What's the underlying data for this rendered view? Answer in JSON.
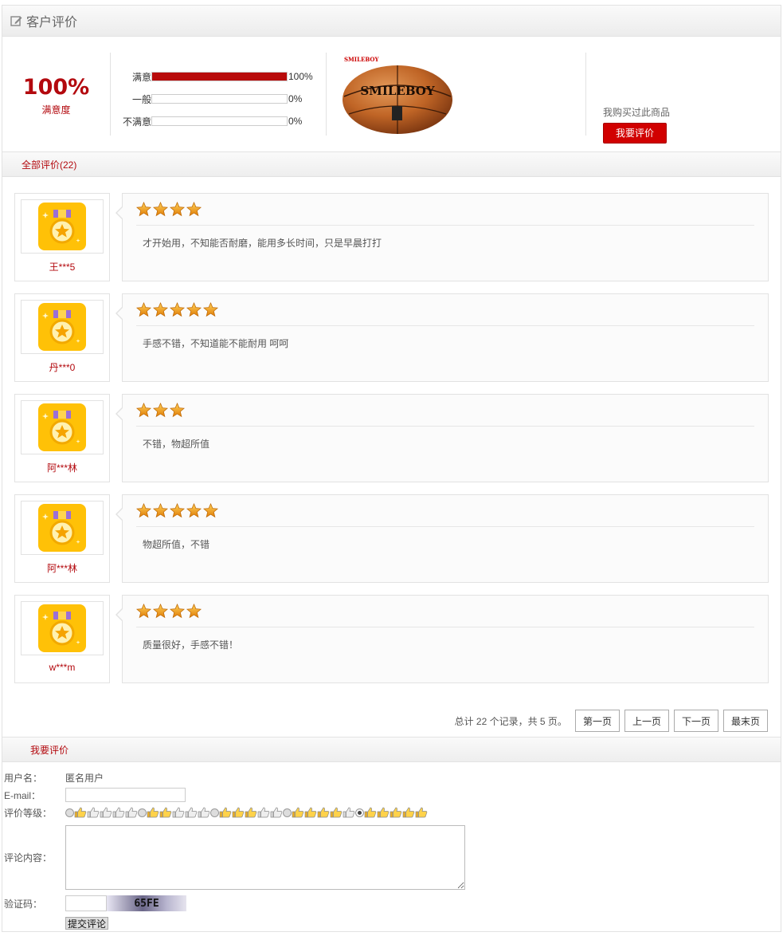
{
  "header": {
    "title": "客户评价"
  },
  "summary": {
    "percent": "100%",
    "percent_label": "满意度",
    "rows": [
      {
        "label": "满意",
        "value": "100%",
        "fill": 1.0
      },
      {
        "label": "一般",
        "value": "0%",
        "fill": 0
      },
      {
        "label": "不满意",
        "value": "0%",
        "fill": 0
      }
    ],
    "product_brand_small": "SMILEBOY",
    "product_brand": "SMILEBOY",
    "buy_text": "我购买过此商品",
    "buy_button": "我要评价"
  },
  "tab_all": "全部评价(22)",
  "reviews": [
    {
      "user": "王***5",
      "stars": 4,
      "text": "才开始用，不知能否耐磨，能用多长时间，只是早晨打打"
    },
    {
      "user": "丹***0",
      "stars": 5,
      "text": "手感不错，不知道能不能耐用 呵呵"
    },
    {
      "user": "阿***林",
      "stars": 3,
      "text": "不错，物超所值"
    },
    {
      "user": "阿***林",
      "stars": 5,
      "text": "物超所值，不错"
    },
    {
      "user": "w***m",
      "stars": 4,
      "text": "质量很好，手感不错！"
    }
  ],
  "pager": {
    "summary": "总计 22 个记录，共 5 页。",
    "first": "第一页",
    "prev": "上一页",
    "next": "下一页",
    "last": "最末页"
  },
  "tab_write": "我要评价",
  "form": {
    "username_label": "用户名：",
    "username_value": "匿名用户",
    "email_label": "E-mail：",
    "email_value": "",
    "level_label": "评价等级：",
    "levels": [
      1,
      2,
      3,
      4,
      5
    ],
    "selected_level": 5,
    "content_label": "评论内容：",
    "captcha_label": "验证码：",
    "captcha_value": "",
    "captcha_text": "65FE",
    "submit": "提交评论"
  }
}
